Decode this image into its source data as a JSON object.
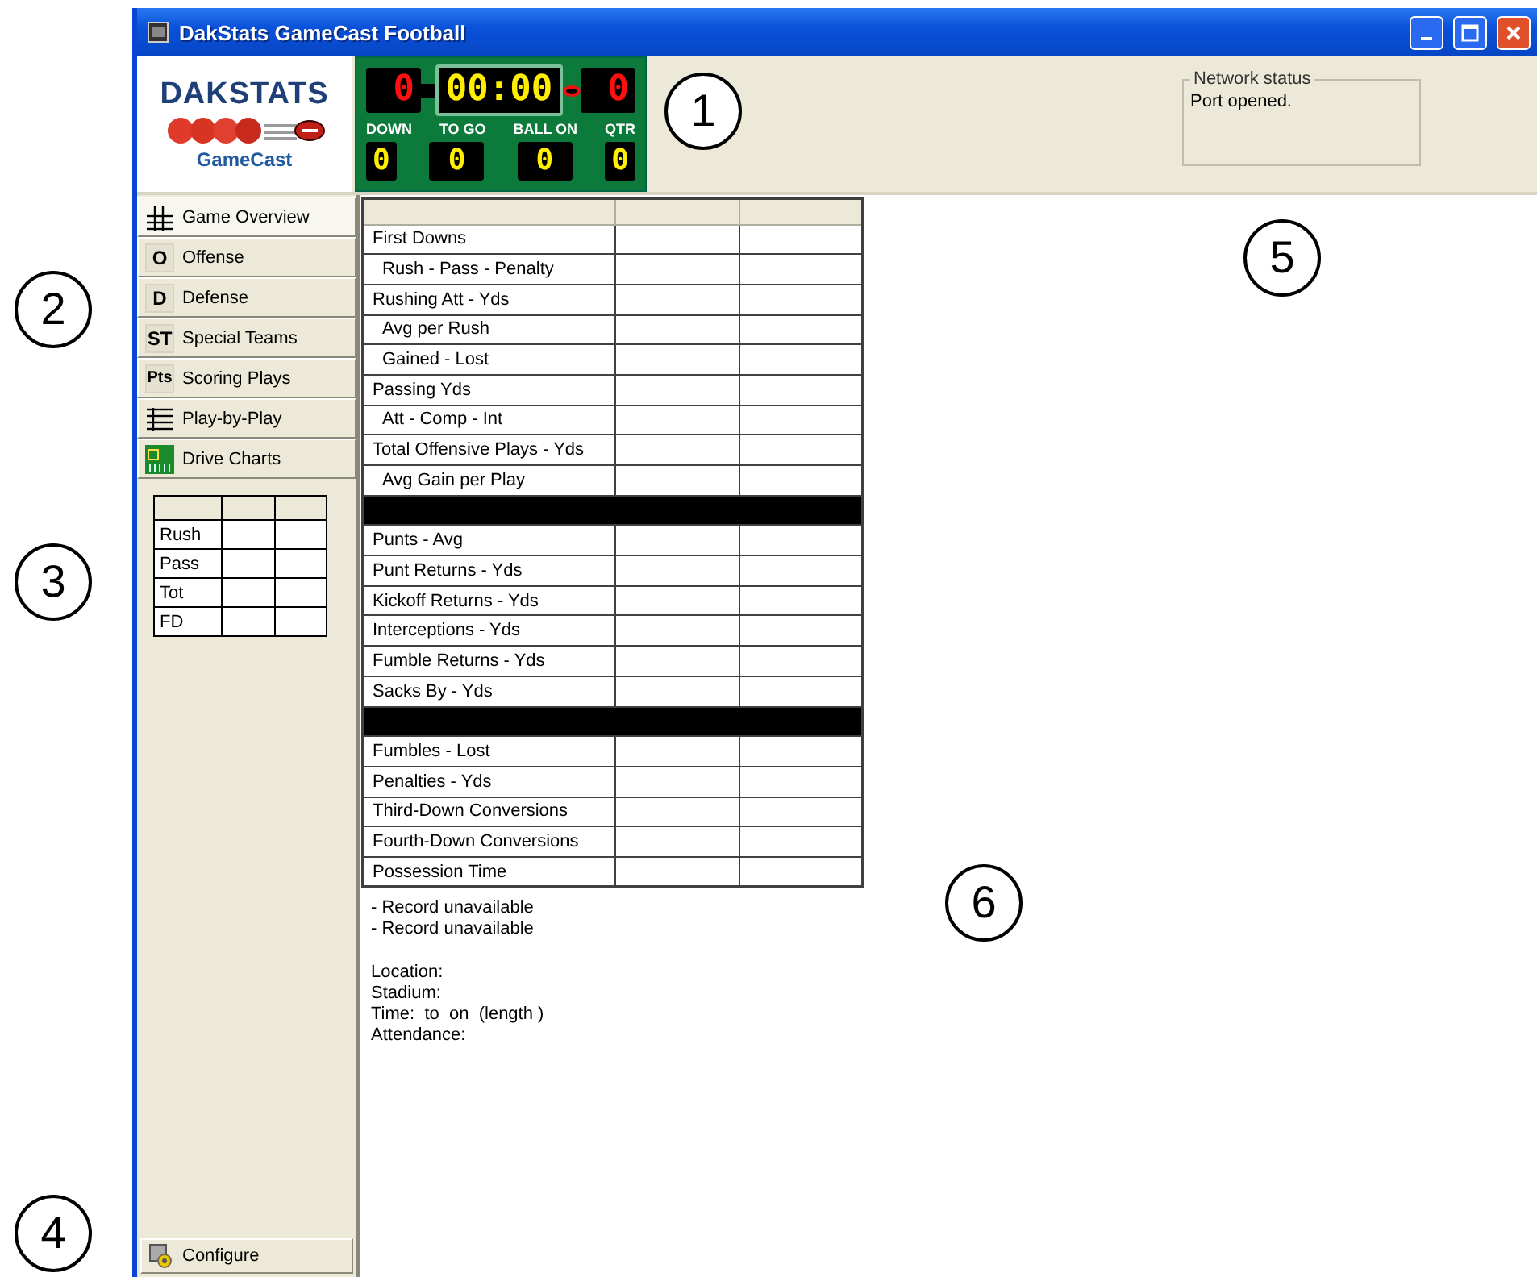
{
  "window": {
    "title": "DakStats GameCast Football"
  },
  "logo": {
    "brand": "DAKSTATS",
    "product": "GameCast"
  },
  "scoreboard": {
    "home_score": "0",
    "clock": "00:00",
    "away_score": "0",
    "possession_marker": true,
    "fields": [
      {
        "label": "DOWN",
        "value": "0"
      },
      {
        "label": "TO GO",
        "value": "0"
      },
      {
        "label": "BALL ON",
        "value": "0"
      },
      {
        "label": "QTR",
        "value": "0"
      }
    ]
  },
  "network_status": {
    "title": "Network status",
    "message": "Port opened."
  },
  "sidebar": {
    "items": [
      {
        "label": "Game Overview",
        "kind": "grid",
        "selected": true
      },
      {
        "label": "Offense",
        "kind": "letter",
        "icon_text": "O",
        "selected": false
      },
      {
        "label": "Defense",
        "kind": "letter",
        "icon_text": "D",
        "selected": false
      },
      {
        "label": "Special Teams",
        "kind": "letter",
        "icon_text": "ST",
        "selected": false
      },
      {
        "label": "Scoring Plays",
        "kind": "letter",
        "icon_text": "Pts",
        "selected": false
      },
      {
        "label": "Play-by-Play",
        "kind": "list",
        "selected": false
      },
      {
        "label": "Drive Charts",
        "kind": "chart",
        "selected": false
      }
    ],
    "summary_rows": [
      "Rush",
      "Pass",
      "Tot",
      "FD"
    ],
    "configure": "Configure"
  },
  "stats_table": {
    "rows": [
      {
        "kind": "stat",
        "label": "First Downs",
        "children": [
          {
            "label": "Rush - Pass - Penalty"
          }
        ]
      },
      {
        "kind": "stat",
        "label": "Rushing Att - Yds",
        "children": [
          {
            "label": "Avg per Rush"
          },
          {
            "label": "Gained - Lost"
          }
        ]
      },
      {
        "kind": "stat",
        "label": "Passing Yds",
        "children": [
          {
            "label": "Att - Comp - Int"
          }
        ]
      },
      {
        "kind": "stat",
        "label": "Total Offensive Plays - Yds",
        "children": [
          {
            "label": "Avg Gain per Play"
          }
        ]
      },
      {
        "kind": "separator"
      },
      {
        "kind": "stat",
        "label": "Punts - Avg"
      },
      {
        "kind": "stat",
        "label": "Punt Returns - Yds"
      },
      {
        "kind": "stat",
        "label": "Kickoff Returns - Yds"
      },
      {
        "kind": "stat",
        "label": "Interceptions - Yds"
      },
      {
        "kind": "stat",
        "label": "Fumble Returns - Yds"
      },
      {
        "kind": "stat",
        "label": "Sacks By - Yds"
      },
      {
        "kind": "separator"
      },
      {
        "kind": "stat",
        "label": "Fumbles - Lost"
      },
      {
        "kind": "stat",
        "label": "Penalties - Yds"
      },
      {
        "kind": "stat",
        "label": "Third-Down Conversions"
      },
      {
        "kind": "stat",
        "label": "Fourth-Down Conversions"
      },
      {
        "kind": "stat",
        "label": "Possession Time"
      }
    ]
  },
  "records": [
    "- Record unavailable",
    "- Record unavailable"
  ],
  "game_info": [
    "Location:",
    "Stadium:",
    "Time:  to  on  (length )",
    "Attendance:"
  ],
  "callouts": [
    "1",
    "2",
    "3",
    "4",
    "5",
    "6"
  ]
}
